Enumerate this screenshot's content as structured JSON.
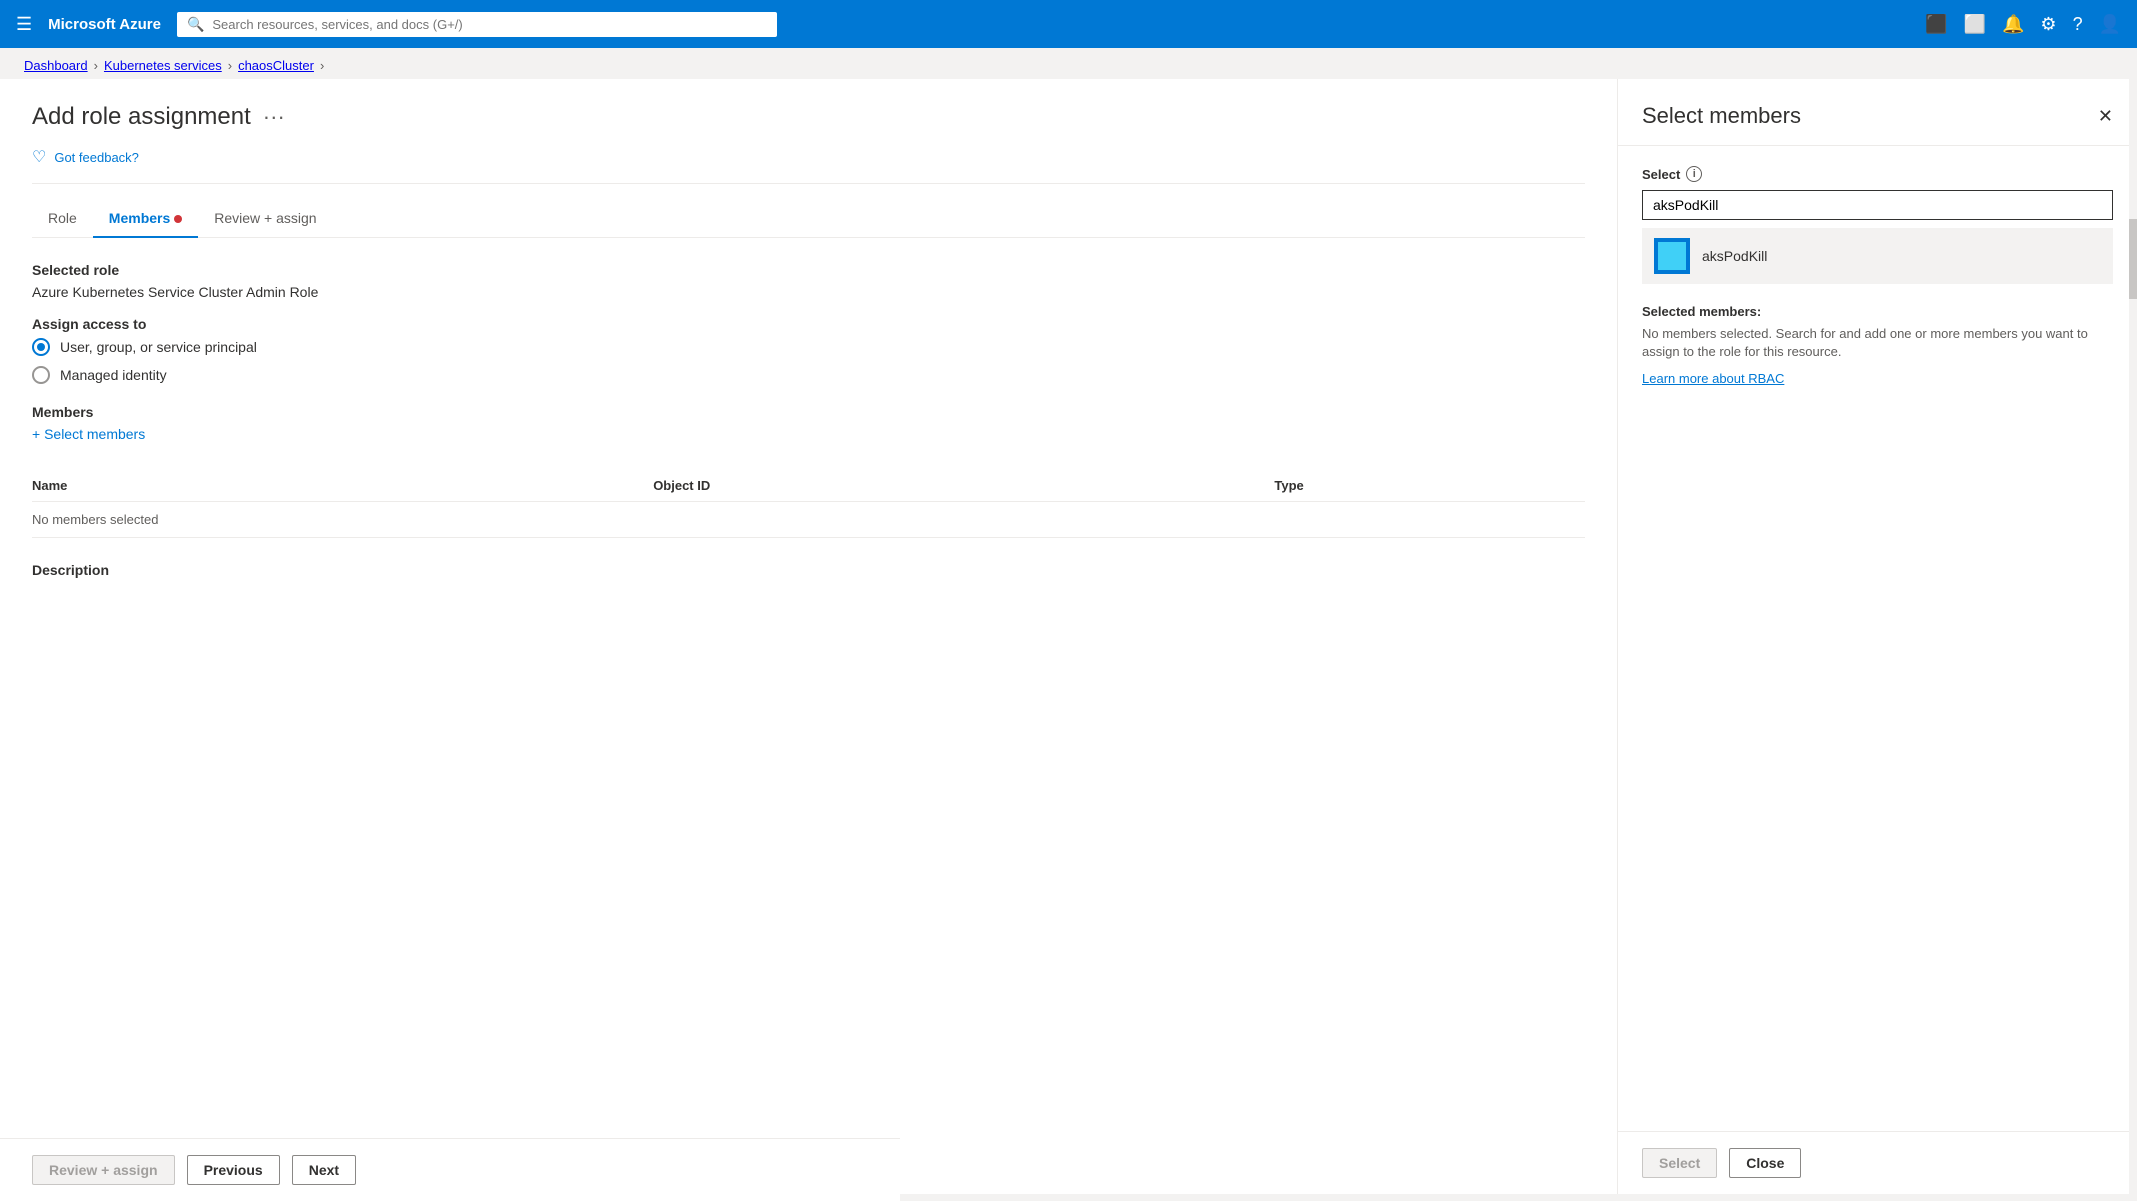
{
  "topnav": {
    "brand": "Microsoft Azure",
    "search_placeholder": "Search resources, services, and docs (G+/)",
    "hamburger_icon": "☰",
    "search_icon": "🔍"
  },
  "breadcrumb": {
    "items": [
      "Dashboard",
      "Kubernetes services",
      "chaosCluster"
    ]
  },
  "page": {
    "title": "Add role assignment",
    "more_icon": "···",
    "feedback_label": "Got feedback?",
    "heart_icon": "♡"
  },
  "tabs": [
    {
      "label": "Role",
      "active": false,
      "has_dot": false
    },
    {
      "label": "Members",
      "active": true,
      "has_dot": true
    },
    {
      "label": "Review + assign",
      "active": false,
      "has_dot": false
    }
  ],
  "form": {
    "selected_role_label": "Selected role",
    "selected_role_value": "Azure Kubernetes Service Cluster Admin Role",
    "assign_access_label": "Assign access to",
    "radio_options": [
      {
        "label": "User, group, or service principal",
        "selected": true
      },
      {
        "label": "Managed identity",
        "selected": false
      }
    ],
    "members_label": "Members",
    "select_members_label": "+ Select members",
    "table": {
      "columns": [
        "Name",
        "Object ID",
        "Type"
      ],
      "empty_row": "No members selected"
    },
    "description_label": "Description"
  },
  "bottom_bar": {
    "review_assign_label": "Review + assign",
    "previous_label": "Previous",
    "next_label": "Next"
  },
  "right_panel": {
    "title": "Select members",
    "close_icon": "✕",
    "select_label": "Select",
    "info_icon": "i",
    "search_value": "aksPodKill",
    "search_placeholder": "",
    "result": {
      "name": "aksPodKill"
    },
    "selected_members_title": "Selected members:",
    "selected_members_desc": "No members selected. Search for and add one or more members you want to assign to the role for this resource.",
    "rbac_link": "Learn more about RBAC",
    "select_button_label": "Select",
    "close_button_label": "Close"
  }
}
